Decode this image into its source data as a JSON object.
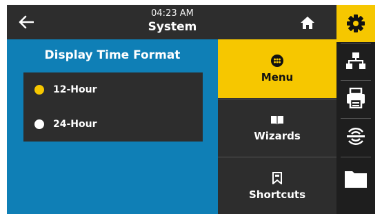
{
  "header": {
    "time": "04:23 AM",
    "title": "System"
  },
  "panel": {
    "title": "Display Time Format",
    "options": [
      {
        "label": "12-Hour",
        "selected": true
      },
      {
        "label": "24-Hour",
        "selected": false
      }
    ]
  },
  "menu": {
    "items": [
      {
        "label": "Menu",
        "icon": "dots-circle-icon",
        "active": true
      },
      {
        "label": "Wizards",
        "icon": "book-open-icon",
        "active": false
      },
      {
        "label": "Shortcuts",
        "icon": "bookmark-icon",
        "active": false
      }
    ]
  },
  "sidebar": {
    "items": [
      {
        "icon": "gear-icon",
        "active": true
      },
      {
        "icon": "network-icon",
        "active": false
      },
      {
        "icon": "printer-icon",
        "active": false
      },
      {
        "icon": "wireless-icon",
        "active": false
      },
      {
        "icon": "folder-icon",
        "active": false
      }
    ]
  },
  "colors": {
    "accent": "#f6c700",
    "panel": "#0f7fb6",
    "dark": "#2d2d2d"
  }
}
